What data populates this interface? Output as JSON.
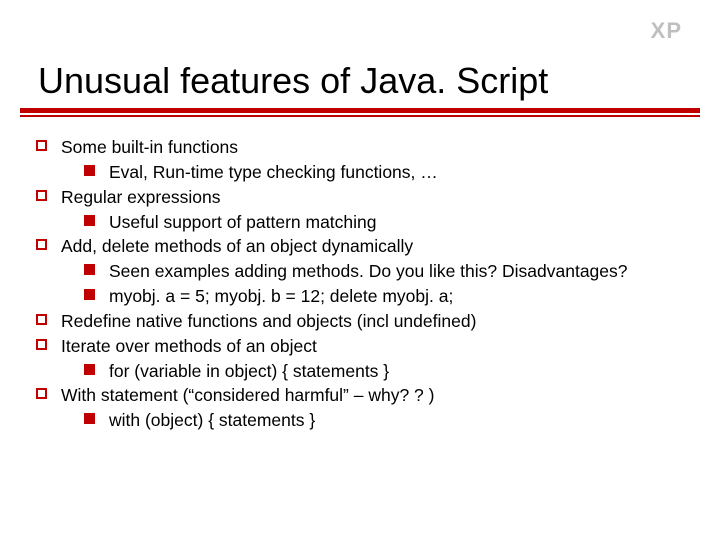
{
  "corner_label": "XP",
  "title": "Unusual features of Java. Script",
  "items": [
    {
      "level": 1,
      "text": "Some built-in functions"
    },
    {
      "level": 2,
      "text": "Eval, Run-time type checking functions, …"
    },
    {
      "level": 1,
      "text": "Regular expressions"
    },
    {
      "level": 2,
      "text": "Useful support of pattern matching"
    },
    {
      "level": 1,
      "text": "Add, delete methods of an object dynamically"
    },
    {
      "level": 2,
      "text": "Seen examples adding methods. Do you like this? Disadvantages?"
    },
    {
      "level": 2,
      "text": "myobj. a = 5; myobj. b = 12; delete myobj. a;"
    },
    {
      "level": 1,
      "text": "Redefine native functions and objects (incl undefined)"
    },
    {
      "level": 1,
      "text": "Iterate over methods of an object"
    },
    {
      "level": 2,
      "text": "for (variable in object) { statements }"
    },
    {
      "level": 1,
      "text": "With statement (“considered harmful” – why? ? )"
    },
    {
      "level": 2,
      "text": "with (object) { statements }"
    }
  ]
}
